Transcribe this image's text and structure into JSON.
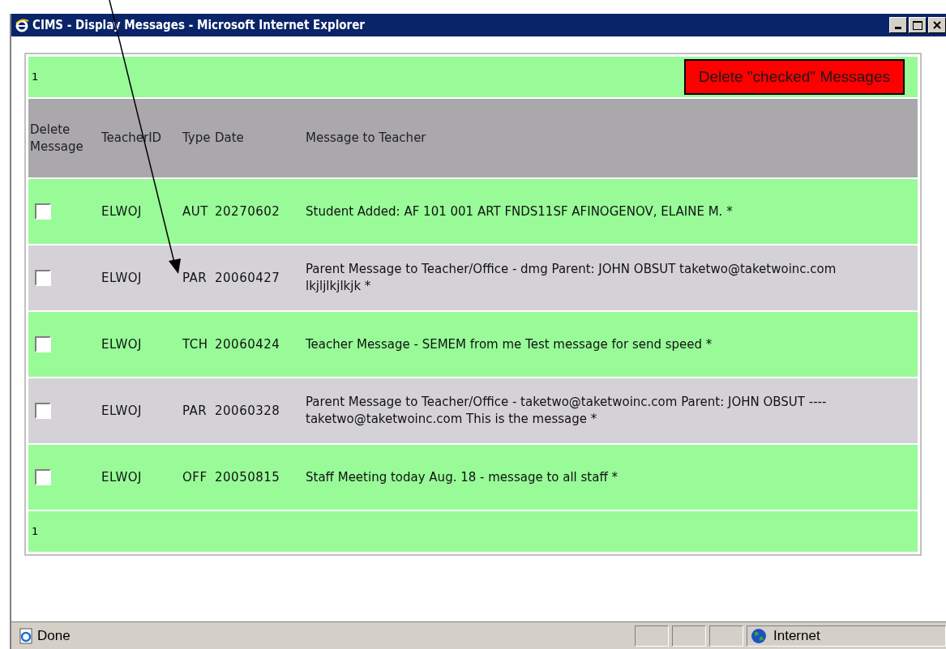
{
  "window": {
    "title": "CIMS - Display Messages - Microsoft Internet Explorer"
  },
  "page_top": {
    "page_number": "1",
    "delete_button": "Delete \"checked\" Messages"
  },
  "table": {
    "columns": [
      "Delete Message",
      "TeacherID",
      "Type",
      "Date",
      "Message to Teacher"
    ],
    "rows": [
      {
        "checked": false,
        "teacher_id": "ELWOJ",
        "type": "AUT",
        "date": "20270602",
        "message": "Student Added: AF 101 001 ART FNDS11SF AFINOGENOV, ELAINE M. *"
      },
      {
        "checked": false,
        "teacher_id": "ELWOJ",
        "type": "PAR",
        "date": "20060427",
        "message": "Parent Message to Teacher/Office - dmg Parent: JOHN OBSUT taketwo@taketwoinc.com lkjljlkjlkjk *"
      },
      {
        "checked": false,
        "teacher_id": "ELWOJ",
        "type": "TCH",
        "date": "20060424",
        "message": "Teacher Message - SEMEM from me Test message for send speed *"
      },
      {
        "checked": false,
        "teacher_id": "ELWOJ",
        "type": "PAR",
        "date": "20060328",
        "message": "Parent Message to Teacher/Office - taketwo@taketwoinc.com Parent: JOHN OBSUT ---- taketwo@taketwoinc.com This is the message *"
      },
      {
        "checked": false,
        "teacher_id": "ELWOJ",
        "type": "OFF",
        "date": "20050815",
        "message": "Staff Meeting today Aug. 18 - message to all staff *"
      }
    ]
  },
  "page_bottom": {
    "page_number": "1"
  },
  "status_bar": {
    "status": "Done",
    "zone": "Internet"
  }
}
